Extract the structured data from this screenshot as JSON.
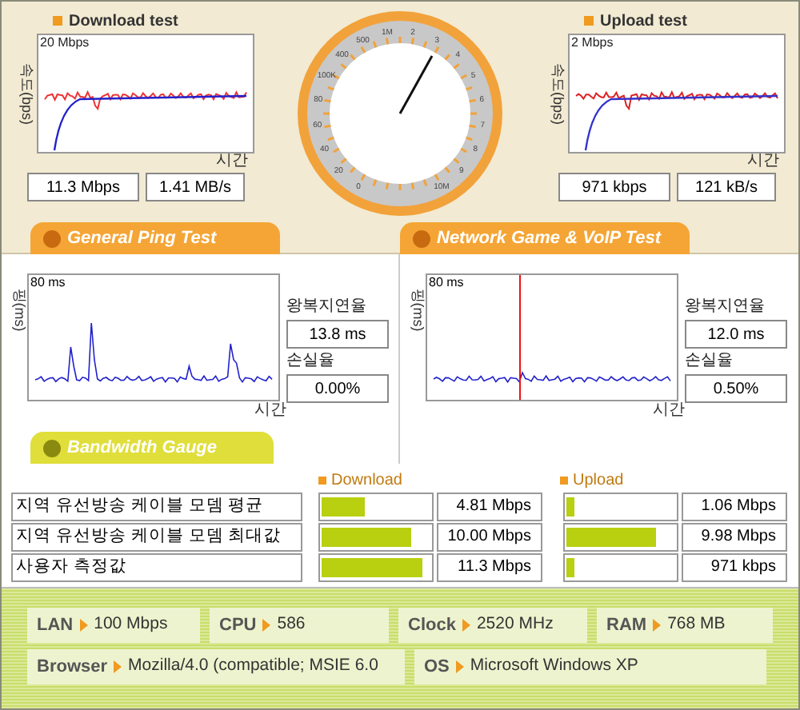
{
  "download": {
    "title": "Download test",
    "axis_label": "속도(bps)",
    "scale": "20 Mbps",
    "time_label": "시간",
    "readings": [
      "11.3 Mbps",
      "1.41 MB/s"
    ]
  },
  "gauge": {
    "labels": [
      "0",
      "20",
      "40",
      "60",
      "80",
      "100K",
      "400",
      "500",
      "1M",
      "2",
      "3",
      "4",
      "5",
      "6",
      "7",
      "8",
      "9",
      "10M"
    ]
  },
  "upload": {
    "title": "Upload test",
    "axis_label": "속도(bps)",
    "scale": "2 Mbps",
    "time_label": "시간",
    "readings": [
      "971 kbps",
      "121 kB/s"
    ]
  },
  "ping_tests": [
    {
      "header": "General Ping Test",
      "axis_label": "핑(ms)",
      "scale": "80 ms",
      "time_label": "시간",
      "latency_label": "왕복지연율",
      "latency": "13.8 ms",
      "loss_label": "손실율",
      "loss": "0.00%"
    },
    {
      "header": "Network Game & VoIP Test",
      "axis_label": "핑(ms)",
      "scale": "80 ms",
      "time_label": "시간",
      "latency_label": "왕복지연율",
      "latency": "12.0 ms",
      "loss_label": "손실율",
      "loss": "0.50%"
    }
  ],
  "bandwidth": {
    "header": "Bandwidth Gauge",
    "download_label": "Download",
    "upload_label": "Upload",
    "rows": [
      {
        "name": "지역 유선방송 케이블 모뎀 평균",
        "download": {
          "level": 0.4,
          "value": "4.81 Mbps"
        },
        "upload": {
          "level": 0.08,
          "value": "1.06 Mbps"
        }
      },
      {
        "name": "지역 유선방송 케이블 모뎀 최대값",
        "download": {
          "level": 0.83,
          "value": "10.00 Mbps"
        },
        "upload": {
          "level": 0.82,
          "value": "9.98 Mbps"
        }
      },
      {
        "name": "사용자 측정값",
        "download": {
          "level": 0.93,
          "value": "11.3 Mbps"
        },
        "upload": {
          "level": 0.07,
          "value": "971 kbps"
        }
      }
    ]
  },
  "system": [
    [
      {
        "label": "LAN",
        "value": "100 Mbps"
      },
      {
        "label": "CPU",
        "value": "586"
      },
      {
        "label": "Clock",
        "value": "2520 MHz"
      },
      {
        "label": "RAM",
        "value": "768 MB"
      }
    ],
    [
      {
        "label": "Browser",
        "value": "Mozilla/4.0 (compatible; MSIE 6.0"
      },
      {
        "label": "OS",
        "value": "Microsoft Windows XP"
      }
    ]
  ]
}
